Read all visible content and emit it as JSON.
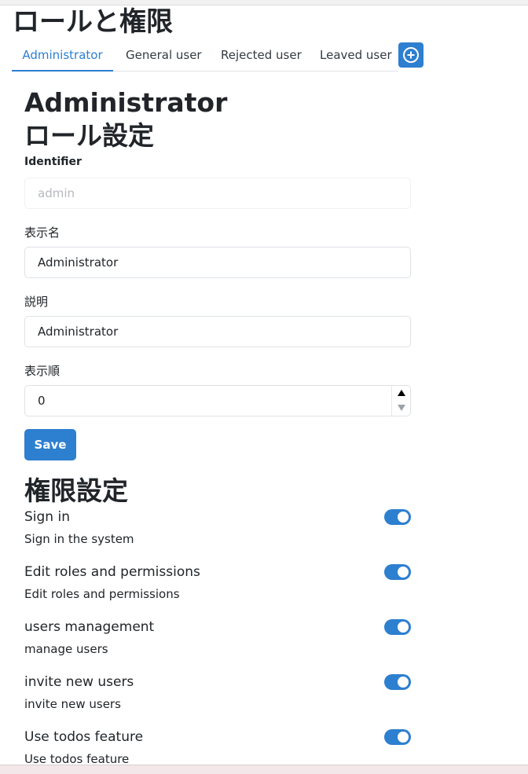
{
  "page": {
    "title": "ロールと権限"
  },
  "tabs": [
    {
      "label": "Administrator",
      "active": true
    },
    {
      "label": "General user"
    },
    {
      "label": "Rejected user"
    },
    {
      "label": "Leaved user"
    }
  ],
  "add_tab_icon": "plus-circle-icon",
  "role": {
    "title_line1": "Administrator",
    "title_line2": "ロール設定",
    "identifier_label": "Identifier",
    "identifier_value": "admin",
    "display_name_label": "表示名",
    "display_name_value": "Administrator",
    "description_label": "説明",
    "description_value": "Administrator",
    "order_label": "表示順",
    "order_value": "0",
    "save_label": "Save"
  },
  "permissions": {
    "title": "権限設定",
    "items": [
      {
        "name": "Sign in",
        "description": "Sign in the system",
        "enabled": true
      },
      {
        "name": "Edit roles and permissions",
        "description": "Edit roles and permissions",
        "enabled": true
      },
      {
        "name": "users management",
        "description": "manage users",
        "enabled": true
      },
      {
        "name": "invite new users",
        "description": "invite new users",
        "enabled": true
      },
      {
        "name": "Use todos feature",
        "description": "Use todos feature",
        "enabled": true
      }
    ]
  },
  "colors": {
    "accent": "#2d7fcf",
    "text": "#212529",
    "border": "#dee2e6"
  }
}
